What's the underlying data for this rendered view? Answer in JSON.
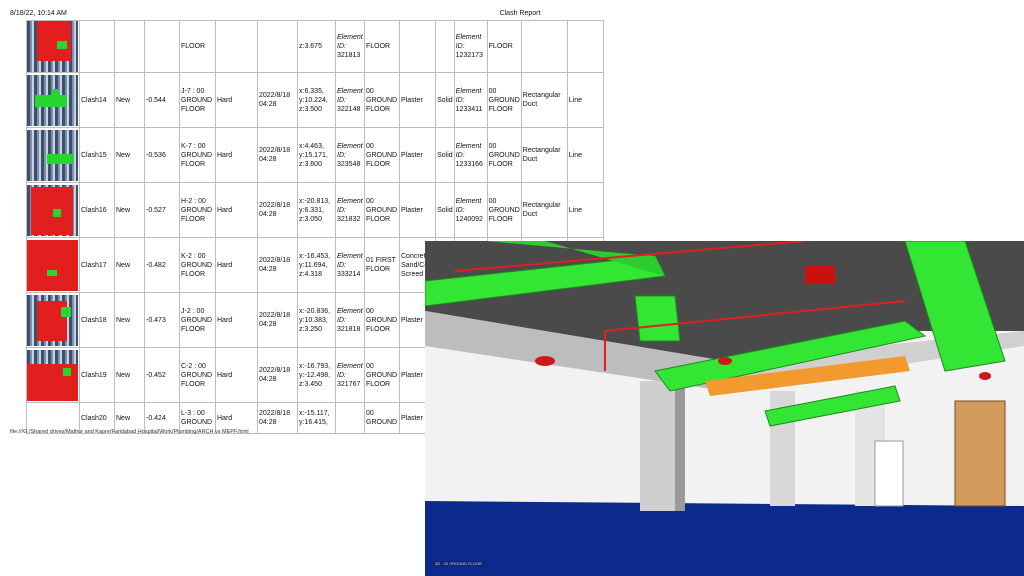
{
  "print": {
    "date": "8/18/22, 10:14 AM",
    "title": "Clash Report",
    "footer": "file:///G:/Shared drives/Mathur and Kapre/Faridabad Hospital/Work/Plumbing/ARCH vs MEPF.html"
  },
  "rows": [
    {
      "name": "",
      "status": "",
      "distance": "",
      "grid": "FLOOR",
      "type": "",
      "date": "",
      "point": "z:3.675",
      "id1": "321813",
      "layer1": "FLOOR",
      "mat1": "",
      "kind": "",
      "id2": "1232173",
      "layer2": "FLOOR",
      "item2": "",
      "typ2": ""
    },
    {
      "name": "Clash14",
      "status": "New",
      "distance": "-0.544",
      "grid": "J-7 : 00\nGROUND\nFLOOR",
      "type": "Hard",
      "date": "2022/8/18\n04:28",
      "point": "x:6.335,\ny:10.224,\nz:3.500",
      "id1": "322148",
      "layer1": "00\nGROUND\nFLOOR",
      "mat1": "Plaster",
      "kind": "Solid",
      "id2": "1233411",
      "layer2": "00\nGROUND\nFLOOR",
      "item2": "Rectangular\nDuct",
      "typ2": "Line"
    },
    {
      "name": "Clash15",
      "status": "New",
      "distance": "-0.536",
      "grid": "K-7 : 00\nGROUND\nFLOOR",
      "type": "Hard",
      "date": "2022/8/18\n04:28",
      "point": "x:4.463,\ny:15.171,\nz:3.600",
      "id1": "323548",
      "layer1": "00\nGROUND\nFLOOR",
      "mat1": "Plaster",
      "kind": "Solid",
      "id2": "1233166",
      "layer2": "00\nGROUND\nFLOOR",
      "item2": "Rectangular\nDuct",
      "typ2": "Line"
    },
    {
      "name": "Clash16",
      "status": "New",
      "distance": "-0.527",
      "grid": "H-2 : 00\nGROUND\nFLOOR",
      "type": "Hard",
      "date": "2022/8/18\n04:28",
      "point": "x:-20.813,\ny:6.331,\nz:3.050",
      "id1": "321832",
      "layer1": "00\nGROUND\nFLOOR",
      "mat1": "Plaster",
      "kind": "Solid",
      "id2": "1240092",
      "layer2": "00\nGROUND\nFLOOR",
      "item2": "Rectangular\nDuct",
      "typ2": "Line"
    },
    {
      "name": "Clash17",
      "status": "New",
      "distance": "-0.482",
      "grid": "K-2 : 00\nGROUND\nFLOOR",
      "type": "Hard",
      "date": "2022/8/18\n04:28",
      "point": "x:-16.453,\ny:11.694,\nz:4.318",
      "id1": "333214",
      "layer1": "01 FIRST\nFLOOR",
      "mat1": "Concrete,\nSand/Cem\nScreed",
      "kind": "",
      "id2": "",
      "layer2": "",
      "item2": "",
      "typ2": ""
    },
    {
      "name": "Clash18",
      "status": "New",
      "distance": "-0.473",
      "grid": "J-2 : 00\nGROUND\nFLOOR",
      "type": "Hard",
      "date": "2022/8/18\n04:28",
      "point": "x:-20.836,\ny:10.383,\nz:3.250",
      "id1": "321818",
      "layer1": "00\nGROUND\nFLOOR",
      "mat1": "Plaster",
      "kind": "",
      "id2": "",
      "layer2": "",
      "item2": "",
      "typ2": ""
    },
    {
      "name": "Clash19",
      "status": "New",
      "distance": "-0.452",
      "grid": "C-2 : 00\nGROUND\nFLOOR",
      "type": "Hard",
      "date": "2022/8/18\n04:28",
      "point": "x:-16.793,\ny:-12.498,\nz:3.450",
      "id1": "321767",
      "layer1": "00\nGROUND\nFLOOR",
      "mat1": "Plaster",
      "kind": "",
      "id2": "",
      "layer2": "",
      "item2": "",
      "typ2": ""
    },
    {
      "name": "Clash20",
      "status": "New",
      "distance": "-0.424",
      "grid": "L-3 : 00\nGROUND",
      "type": "Hard",
      "date": "2022/8/18\n04:28",
      "point": "x:-15.117,\ny:16.415,",
      "id1": "",
      "layer1": "00\nGROUND",
      "mat1": "Plaster",
      "kind": "",
      "id2": "",
      "layer2": "",
      "item2": "",
      "typ2": ""
    }
  ],
  "labels": {
    "element_id": "Element\nID:"
  },
  "render": {
    "view_label": "3D - 00 GROUND FLOOR"
  },
  "colors": {
    "duct": "#33e633",
    "pipe": "#e02020",
    "floor": "#0b2a8c",
    "ceiling": "#4a4a4a"
  }
}
